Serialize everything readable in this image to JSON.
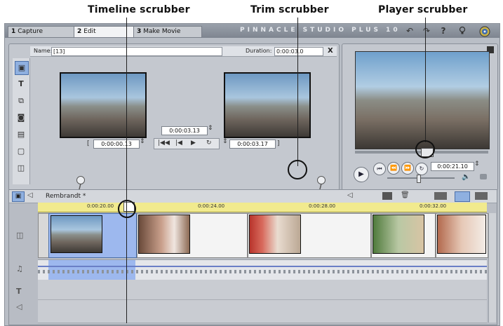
{
  "annotations": {
    "timeline": "Timeline scrubber",
    "trim": "Trim scrubber",
    "player": "Player scrubber"
  },
  "tabs": [
    {
      "num": "1",
      "label": "Capture"
    },
    {
      "num": "2",
      "label": "Edit"
    },
    {
      "num": "3",
      "label": "Make Movie"
    }
  ],
  "brand": "PINNACLE STUDIO PLUS 10",
  "toolbar_icons": [
    "undo-icon",
    "redo-icon",
    "help-icon",
    "lightbulb-icon",
    "disc-icon"
  ],
  "editor": {
    "name_label": "Name:",
    "name_value": "[13]",
    "duration_label": "Duration:",
    "duration_value": "0:00:03.0",
    "close_glyph": "X",
    "sidebar_icons": [
      "video-toolbox-icon",
      "title-icon",
      "overlay-icon",
      "effects-icon",
      "menu-icon",
      "text-icon",
      "audio-icon"
    ],
    "mark_in": "0:00:00.13",
    "mark_out": "0:00:03.17",
    "current": "0:00:03.13",
    "transport": [
      "|◀◀",
      "|◀",
      "▶",
      "↻"
    ]
  },
  "player": {
    "time": "0:00:21.10"
  },
  "timeline": {
    "project_name": "Rembrandt *",
    "ruler_ticks": [
      "0:00:20.00",
      "0:00:24.00",
      "0:00:28.00",
      "0:00:32.00"
    ],
    "track_icons": [
      "video-track-icon",
      "audio-track-icon",
      "title-track-icon",
      "sound-track-icon"
    ]
  },
  "colors": {
    "ruler": "#f1ea8e",
    "selected_clip": "#9db8ee",
    "accent_blue": "#4b6fa8"
  }
}
